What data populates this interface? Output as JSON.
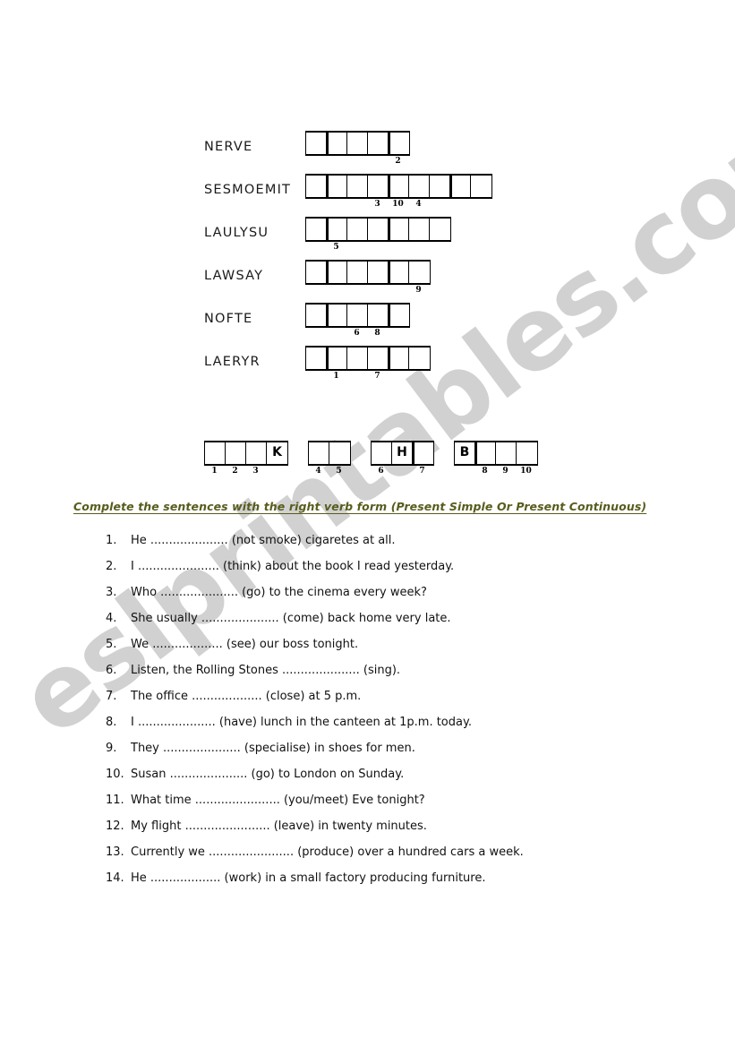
{
  "watermark": {
    "text": "eslprintables.com",
    "color": "#c9c9c9"
  },
  "anagram_puzzle": {
    "rows": [
      {
        "word": "NERVE",
        "cells": 5,
        "thick_dividers": [
          2,
          5
        ],
        "numbers": {
          "5": "2"
        }
      },
      {
        "word": "SESMOEMIT",
        "cells": 9,
        "thick_dividers": [
          2,
          5,
          8
        ],
        "numbers": {
          "4": "3",
          "5": "10",
          "6": "4"
        }
      },
      {
        "word": "LAULYSU",
        "cells": 7,
        "thick_dividers": [
          2,
          5
        ],
        "numbers": {
          "2": "5"
        }
      },
      {
        "word": "LAWSAY",
        "cells": 6,
        "thick_dividers": [
          2,
          5
        ],
        "numbers": {
          "6": "9"
        }
      },
      {
        "word": "NOFTE",
        "cells": 5,
        "thick_dividers": [
          2,
          5
        ],
        "numbers": {
          "3": "6",
          "4": "8"
        }
      },
      {
        "word": "LAERYR",
        "cells": 6,
        "thick_dividers": [
          2,
          5
        ],
        "numbers": {
          "2": "1",
          "4": "7"
        }
      }
    ]
  },
  "answer_row": {
    "groups": [
      {
        "cells": 4,
        "letters": {
          "4": "K"
        },
        "numbers": {
          "1": "1",
          "2": "2",
          "3": "3"
        }
      },
      {
        "cells": 2,
        "letters": {},
        "numbers": {
          "1": "4",
          "2": "5"
        }
      },
      {
        "cells": 3,
        "letters": {
          "2": "H"
        },
        "numbers": {
          "1": "6",
          "3": "7"
        },
        "thick_dividers": [
          3
        ]
      },
      {
        "cells": 4,
        "letters": {
          "1": "B"
        },
        "numbers": {
          "2": "8",
          "3": "9",
          "4": "10"
        },
        "thick_dividers": [
          2
        ]
      }
    ]
  },
  "instruction": {
    "text": "Complete the sentences with the right verb form (Present Simple Or Present Continuous)",
    "color": "#585c1c"
  },
  "sentences": [
    {
      "num": "1.",
      "text": "He ..................... (not smoke) cigaretes at all."
    },
    {
      "num": "2.",
      "text": "I ...................... (think) about the book I read yesterday."
    },
    {
      "num": "3.",
      "text": "Who ..................... (go) to the cinema every week?"
    },
    {
      "num": "4.",
      "text": "She usually ..................... (come) back home very late."
    },
    {
      "num": "5.",
      "text": "We ................... (see) our boss tonight."
    },
    {
      "num": "6.",
      "text": "Listen, the Rolling Stones ..................... (sing)."
    },
    {
      "num": "7.",
      "text": "The office ................... (close) at 5 p.m."
    },
    {
      "num": "8.",
      "text": "I ..................... (have) lunch in the canteen at 1p.m. today."
    },
    {
      "num": "9.",
      "text": "They ..................... (specialise) in shoes for men."
    },
    {
      "num": "10.",
      "text": "Susan ..................... (go) to London on Sunday."
    },
    {
      "num": "11.",
      "text": "What time ....................... (you/meet) Eve tonight?"
    },
    {
      "num": "12.",
      "text": "My flight ....................... (leave) in twenty minutes."
    },
    {
      "num": "13.",
      "text": "Currently we ....................... (produce) over a hundred cars a week."
    },
    {
      "num": "14.",
      "text": "He ................... (work) in a small factory producing furniture."
    }
  ]
}
